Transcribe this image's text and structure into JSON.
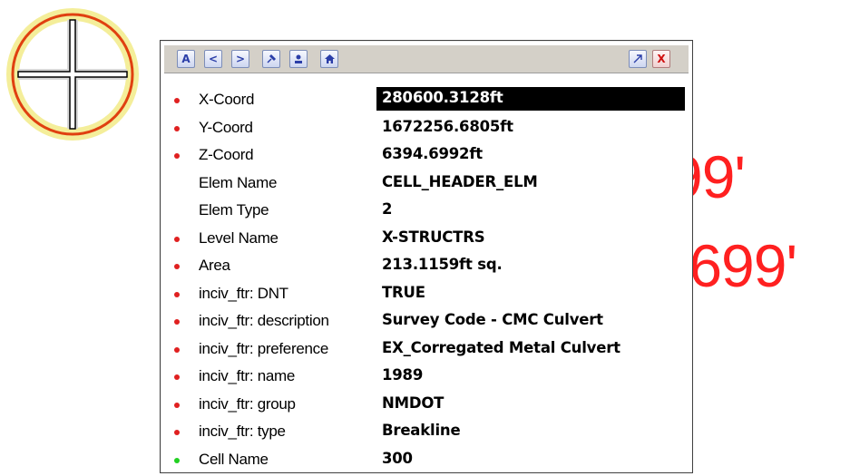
{
  "background_text": {
    "line1": "99'",
    "line2": ".699'"
  },
  "colors": {
    "background_text": "#ff2020",
    "bullet_red": "#e02020",
    "bullet_green": "#22d022",
    "selection": "#000000",
    "target_ring": "#e04010",
    "target_halo": "#f4ee9a"
  },
  "toolbar": {
    "buttons": [
      {
        "name": "font-icon",
        "glyph": "A"
      },
      {
        "name": "previous-icon",
        "glyph": "<"
      },
      {
        "name": "next-icon",
        "glyph": ">"
      },
      {
        "name": "pin-icon"
      },
      {
        "name": "user-icon"
      },
      {
        "name": "home-icon"
      },
      {
        "name": "expand-icon"
      },
      {
        "name": "close-icon",
        "glyph": "X"
      }
    ]
  },
  "properties": [
    {
      "label": "X-Coord",
      "value": "280600.3128ft",
      "bullet": "red",
      "selected": true
    },
    {
      "label": "Y-Coord",
      "value": "1672256.6805ft",
      "bullet": "red"
    },
    {
      "label": "Z-Coord",
      "value": "6394.6992ft",
      "bullet": "red"
    },
    {
      "label": "Elem Name",
      "value": "CELL_HEADER_ELM",
      "bullet": "none"
    },
    {
      "label": "Elem Type",
      "value": "2",
      "bullet": "none"
    },
    {
      "label": "Level Name",
      "value": "X-STRUCTRS",
      "bullet": "red"
    },
    {
      "label": "Area",
      "value": "213.1159ft sq.",
      "bullet": "red"
    },
    {
      "label": "inciv_ftr: DNT",
      "value": "TRUE",
      "bullet": "red"
    },
    {
      "label": "inciv_ftr: description",
      "value": "Survey Code - CMC Culvert",
      "bullet": "red"
    },
    {
      "label": "inciv_ftr: preference",
      "value": "EX_Corregated Metal Culvert",
      "bullet": "red"
    },
    {
      "label": "inciv_ftr: name",
      "value": "1989",
      "bullet": "red"
    },
    {
      "label": "inciv_ftr: group",
      "value": "NMDOT",
      "bullet": "red"
    },
    {
      "label": "inciv_ftr: type",
      "value": "Breakline",
      "bullet": "red"
    },
    {
      "label": "Cell Name",
      "value": "300",
      "bullet": "green"
    }
  ]
}
